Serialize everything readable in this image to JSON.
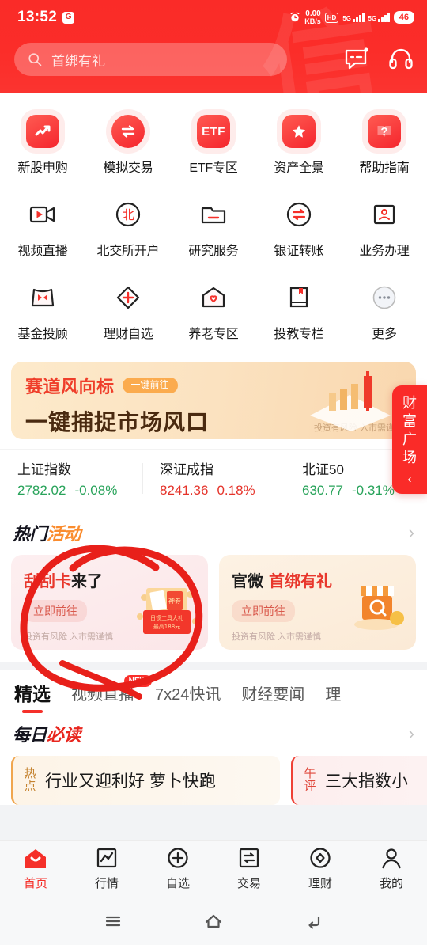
{
  "statusbar": {
    "time": "13:52",
    "app_icon": "G",
    "alarm_icon": "alarm-clock-icon",
    "net_speed_value": "0.00",
    "net_speed_unit": "KB/s",
    "hd_label": "HD",
    "hd_sup": "1",
    "hd_sub": "2",
    "sim1_label": "5G",
    "sim2_label": "5G",
    "battery": "46"
  },
  "header": {
    "search_placeholder": "首绑有礼",
    "search_icon": "search-icon",
    "message_icon": "message-icon",
    "service_icon": "headset-icon",
    "brand_color": "#fa2b28",
    "watermark": "信"
  },
  "grid": {
    "items": [
      {
        "label": "新股申购",
        "icon": "trend-up-icon"
      },
      {
        "label": "模拟交易",
        "icon": "exchange-arrows-icon"
      },
      {
        "label": "ETF专区",
        "icon": "etf-icon"
      },
      {
        "label": "资产全景",
        "icon": "star-icon"
      },
      {
        "label": "帮助指南",
        "icon": "question-book-icon"
      },
      {
        "label": "视频直播",
        "icon": "video-camera-icon"
      },
      {
        "label": "北交所开户",
        "icon": "bei-circle-icon"
      },
      {
        "label": "研究服务",
        "icon": "folder-icon"
      },
      {
        "label": "银证转账",
        "icon": "transfer-circle-icon"
      },
      {
        "label": "业务办理",
        "icon": "stamp-icon"
      },
      {
        "label": "基金投顾",
        "icon": "bowtie-bag-icon"
      },
      {
        "label": "理财自选",
        "icon": "diamond-plus-icon"
      },
      {
        "label": "养老专区",
        "icon": "house-heart-icon"
      },
      {
        "label": "投教专栏",
        "icon": "bookmark-book-icon"
      },
      {
        "label": "更多",
        "icon": "more-dots-icon"
      }
    ]
  },
  "banner": {
    "title": "赛道风向标",
    "pill": "一键前往",
    "subtitle": "一键捕捉市场风口",
    "risk_note": "投资有风险 入市需谨慎"
  },
  "indices": [
    {
      "name": "上证指数",
      "value": "2782.02",
      "change": "-0.08%",
      "color": "#28a35a",
      "direction": "down"
    },
    {
      "name": "深证成指",
      "value": "8241.36",
      "change": "0.18%",
      "color": "#e5332a",
      "direction": "up"
    },
    {
      "name": "北证50",
      "value": "630.77",
      "change": "-0.31%",
      "color": "#28a35a",
      "direction": "down"
    }
  ],
  "hot_activity": {
    "title_black": "热门",
    "title_orange": "活动",
    "more_icon": "chevron-right-icon",
    "cards": [
      {
        "title_black": "刮刮卡",
        "title_red": "来了",
        "button": "立即前往",
        "risk_note": "投资有风险 入市需谨慎",
        "art": "gift-box-icon",
        "art_line1": "日惯工具大礼",
        "art_line2": "最高188元"
      },
      {
        "title_black": "官微",
        "title_red": "首绑有礼",
        "button": "立即前往",
        "risk_note": "投资有风险 入市需谨慎",
        "art": "shop-icon"
      }
    ]
  },
  "tabs": [
    {
      "label": "精选",
      "active": true,
      "badge": ""
    },
    {
      "label": "视频直播",
      "active": false,
      "badge": "NEW"
    },
    {
      "label": "7x24快讯",
      "active": false,
      "badge": ""
    },
    {
      "label": "财经要闻",
      "active": false,
      "badge": ""
    },
    {
      "label": "理",
      "active": false,
      "badge": ""
    }
  ],
  "daily_read": {
    "title_black": "每日",
    "title_red": "必读",
    "more_icon": "chevron-right-icon",
    "cards": [
      {
        "badge": "热点",
        "text": "行业又迎利好 萝卜快跑"
      },
      {
        "badge": "午评",
        "text": "三大指数小"
      }
    ]
  },
  "side_tab": {
    "chars": [
      "财",
      "富",
      "广",
      "场"
    ],
    "collapse_icon": "chevron-left-icon"
  },
  "bottom_nav": [
    {
      "label": "首页",
      "icon": "home-icon",
      "active": true
    },
    {
      "label": "行情",
      "icon": "quote-chart-icon",
      "active": false
    },
    {
      "label": "自选",
      "icon": "plus-circle-icon",
      "active": false
    },
    {
      "label": "交易",
      "icon": "trade-icon",
      "active": false
    },
    {
      "label": "理财",
      "icon": "finance-diamond-icon",
      "active": false
    },
    {
      "label": "我的",
      "icon": "person-icon",
      "active": false
    }
  ],
  "system_nav": [
    {
      "icon": "menu-icon"
    },
    {
      "icon": "home-outline-icon"
    },
    {
      "icon": "back-icon"
    }
  ],
  "annotation": {
    "shape": "hand-drawn-red-circle",
    "color": "#e8201a"
  }
}
